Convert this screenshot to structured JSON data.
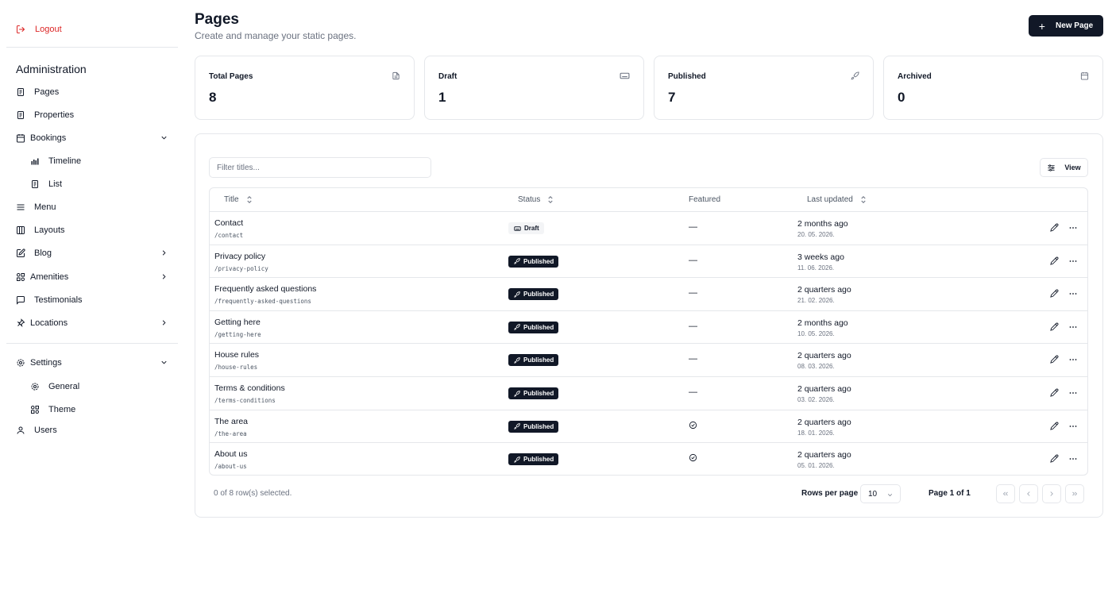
{
  "sidebar": {
    "logout_label": "Logout",
    "section_title": "Administration",
    "items": {
      "pages": "Pages",
      "properties": "Properties",
      "bookings": "Bookings",
      "timeline": "Timeline",
      "list": "List",
      "menu": "Menu",
      "layouts": "Layouts",
      "blog": "Blog",
      "amenities": "Amenities",
      "testimonials": "Testimonials",
      "locations": "Locations",
      "settings": "Settings",
      "general": "General",
      "theme": "Theme",
      "users": "Users"
    }
  },
  "header": {
    "title": "Pages",
    "subtitle": "Create and manage your static pages.",
    "new_button": "New Page"
  },
  "stats": [
    {
      "label": "Total Pages",
      "value": "8",
      "icon": "file-icon"
    },
    {
      "label": "Draft",
      "value": "1",
      "icon": "keyboard-icon"
    },
    {
      "label": "Published",
      "value": "7",
      "icon": "rocket-icon"
    },
    {
      "label": "Archived",
      "value": "0",
      "icon": "calendar-icon"
    }
  ],
  "table": {
    "filter_placeholder": "Filter titles...",
    "view_button": "View",
    "columns": {
      "title": "Title",
      "status": "Status",
      "featured": "Featured",
      "updated": "Last updated"
    },
    "rows": [
      {
        "title": "Contact",
        "slug": "/contact",
        "status": "Draft",
        "featured": "—",
        "relative": "2 months ago",
        "date": "20. 05. 2026."
      },
      {
        "title": "Privacy policy",
        "slug": "/privacy-policy",
        "status": "Published",
        "featured": "—",
        "relative": "3 weeks ago",
        "date": "11. 06. 2026."
      },
      {
        "title": "Frequently asked questions",
        "slug": "/frequently-asked-questions",
        "status": "Published",
        "featured": "—",
        "relative": "2 quarters ago",
        "date": "21. 02. 2026."
      },
      {
        "title": "Getting here",
        "slug": "/getting-here",
        "status": "Published",
        "featured": "—",
        "relative": "2 months ago",
        "date": "10. 05. 2026."
      },
      {
        "title": "House rules",
        "slug": "/house-rules",
        "status": "Published",
        "featured": "—",
        "relative": "2 quarters ago",
        "date": "08. 03. 2026."
      },
      {
        "title": "Terms & conditions",
        "slug": "/terms-conditions",
        "status": "Published",
        "featured": "—",
        "relative": "2 quarters ago",
        "date": "03. 02. 2026."
      },
      {
        "title": "The area",
        "slug": "/the-area",
        "status": "Published",
        "featured": "check",
        "relative": "2 quarters ago",
        "date": "18. 01. 2026."
      },
      {
        "title": "About us",
        "slug": "/about-us",
        "status": "Published",
        "featured": "check",
        "relative": "2 quarters ago",
        "date": "05. 01. 2026."
      }
    ]
  },
  "footer": {
    "selected_text": "0 of 8 row(s) selected.",
    "rows_per_page_label": "Rows per page",
    "rows_per_page_value": "10",
    "page_info": "Page 1 of 1"
  },
  "colors": {
    "logout": "#dc2626",
    "primary": "#111827",
    "muted": "#6b7280",
    "border": "#e5e7eb"
  }
}
